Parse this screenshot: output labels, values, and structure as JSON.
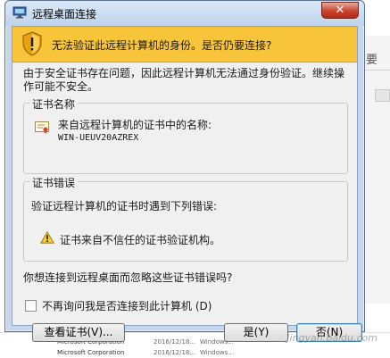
{
  "window": {
    "title": "远程桌面连接",
    "close_label": "✕"
  },
  "banner": {
    "text": "无法验证此远程计算机的身份。是否仍要连接?"
  },
  "intro_text": "由于安全证书存在问题，因此远程计算机无法通过身份验证。继续操作可能不安全。",
  "certificate_group": {
    "title": "证书名称",
    "line1": "来自远程计算机的证书中的名称:",
    "name": "WIN-UEUV20AZREX"
  },
  "error_group": {
    "title": "证书错误",
    "line1": "验证远程计算机的证书时遇到下列错误:",
    "error": "证书来自不信任的证书验证机构。"
  },
  "question": "你想连接到远程桌面而忽略这些证书错误吗?",
  "checkbox": {
    "label": "不再询问我是否连接到此计算机 (D)",
    "checked": false
  },
  "buttons": {
    "view_cert": "查看证书(V)...",
    "yes": "是(Y)",
    "no": "否(N)"
  },
  "background": {
    "side_text": "要",
    "rows": [
      {
        "name": "Microsoft Corporation",
        "date": "2016/12/18...",
        "type": "Windows..."
      },
      {
        "name": "Microsoft Corporation",
        "date": "2016/12/18...",
        "type": "Windows..."
      }
    ],
    "watermark": "Jingyan.baidu.com"
  },
  "colors": {
    "banner": "#f8c53a",
    "dialog_bg": "#f0f0f0",
    "frame": "#c4d7ef",
    "close_button": "#c8432e"
  }
}
